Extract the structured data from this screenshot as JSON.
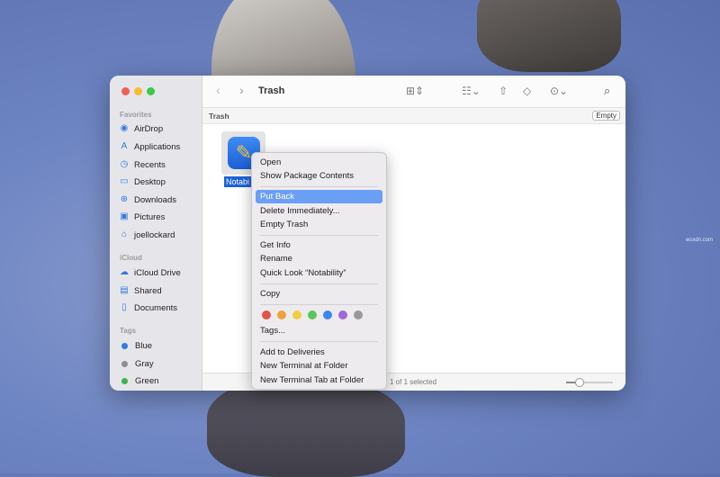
{
  "window": {
    "title": "Trash",
    "path_label": "Trash",
    "empty_button": "Empty",
    "status": "1 of 1 selected"
  },
  "sidebar": {
    "favorites_header": "Favorites",
    "favorites": [
      {
        "label": "AirDrop",
        "icon": "airdrop-icon"
      },
      {
        "label": "Applications",
        "icon": "applications-icon"
      },
      {
        "label": "Recents",
        "icon": "clock-icon"
      },
      {
        "label": "Desktop",
        "icon": "desktop-icon"
      },
      {
        "label": "Downloads",
        "icon": "downloads-icon"
      },
      {
        "label": "Pictures",
        "icon": "pictures-icon"
      },
      {
        "label": "joellockard",
        "icon": "home-icon"
      }
    ],
    "icloud_header": "iCloud",
    "icloud": [
      {
        "label": "iCloud Drive",
        "icon": "cloud-icon"
      },
      {
        "label": "Shared",
        "icon": "shared-folder-icon"
      },
      {
        "label": "Documents",
        "icon": "document-icon"
      }
    ],
    "tags_header": "Tags",
    "tags": [
      {
        "label": "Blue",
        "color": "#2f7be0"
      },
      {
        "label": "Gray",
        "color": "#8e8e93"
      },
      {
        "label": "Green",
        "color": "#3cb54a"
      }
    ]
  },
  "file": {
    "name": "Notabi"
  },
  "context_menu": {
    "items": [
      "Open",
      "Show Package Contents",
      "Put Back",
      "Delete Immediately...",
      "Empty Trash",
      "Get Info",
      "Rename",
      "Quick Look “Notability”",
      "Copy",
      "Tags...",
      "Add to Deliveries",
      "New Terminal at Folder",
      "New Terminal Tab at Folder"
    ],
    "highlighted": "Put Back",
    "tag_colors": [
      "#e5534b",
      "#f0a03c",
      "#f3cd3f",
      "#5cc65a",
      "#3d86f0",
      "#a067d6",
      "#999999"
    ]
  },
  "watermark": "wsxdn.com"
}
